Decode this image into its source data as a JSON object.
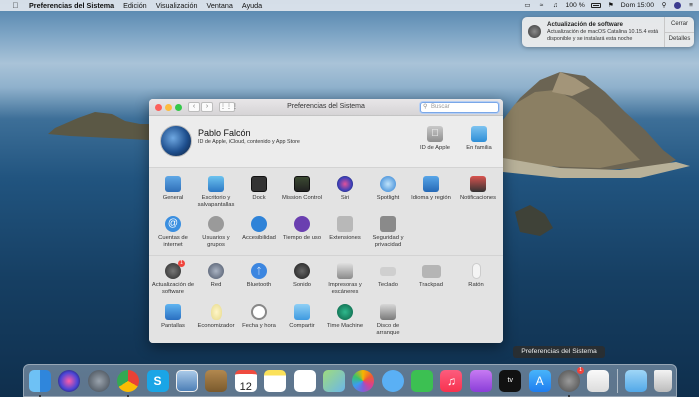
{
  "menubar": {
    "apple": "",
    "app": "Preferencias del Sistema",
    "items": [
      "Edición",
      "Visualización",
      "Ventana",
      "Ayuda"
    ],
    "battery": "100 %",
    "clock": "Dom 15:00"
  },
  "notification": {
    "title": "Actualización de software",
    "body": "Actualización de macOS Catalina 10.15.4 está disponible y se instalará esta noche",
    "close_label": "Cerrar",
    "details_label": "Detalles"
  },
  "window": {
    "title": "Preferencias del Sistema",
    "search_placeholder": "Buscar",
    "user": {
      "name": "Pablo Falcón",
      "subtitle": "ID de Apple, iCloud, contenido y App Store",
      "apple_id_label": "ID de Apple",
      "family_label": "En familia"
    },
    "row1": [
      "General",
      "Escritorio y salvapantallas",
      "Dock",
      "Mission Control",
      "Siri",
      "Spotlight",
      "Idioma y región",
      "Notificaciones"
    ],
    "row2": [
      "Cuentas de internet",
      "Usuarios y grupos",
      "Accesibilidad",
      "Tiempo de uso",
      "Extensiones",
      "Seguridad y privacidad"
    ],
    "row3": [
      "Actualización de software",
      "Red",
      "Bluetooth",
      "Sonido",
      "Impresoras y escáneres",
      "Teclado",
      "Trackpad",
      "Ratón"
    ],
    "row4": [
      "Pantallas",
      "Economizador",
      "Fecha y hora",
      "Compartir",
      "Time Machine",
      "Disco de arranque"
    ],
    "update_badge": "1"
  },
  "dock": {
    "tooltip": "Preferencias del Sistema",
    "calendar_day": "12",
    "sysprefs_badge": "1",
    "apple_tv_label": "tv"
  }
}
